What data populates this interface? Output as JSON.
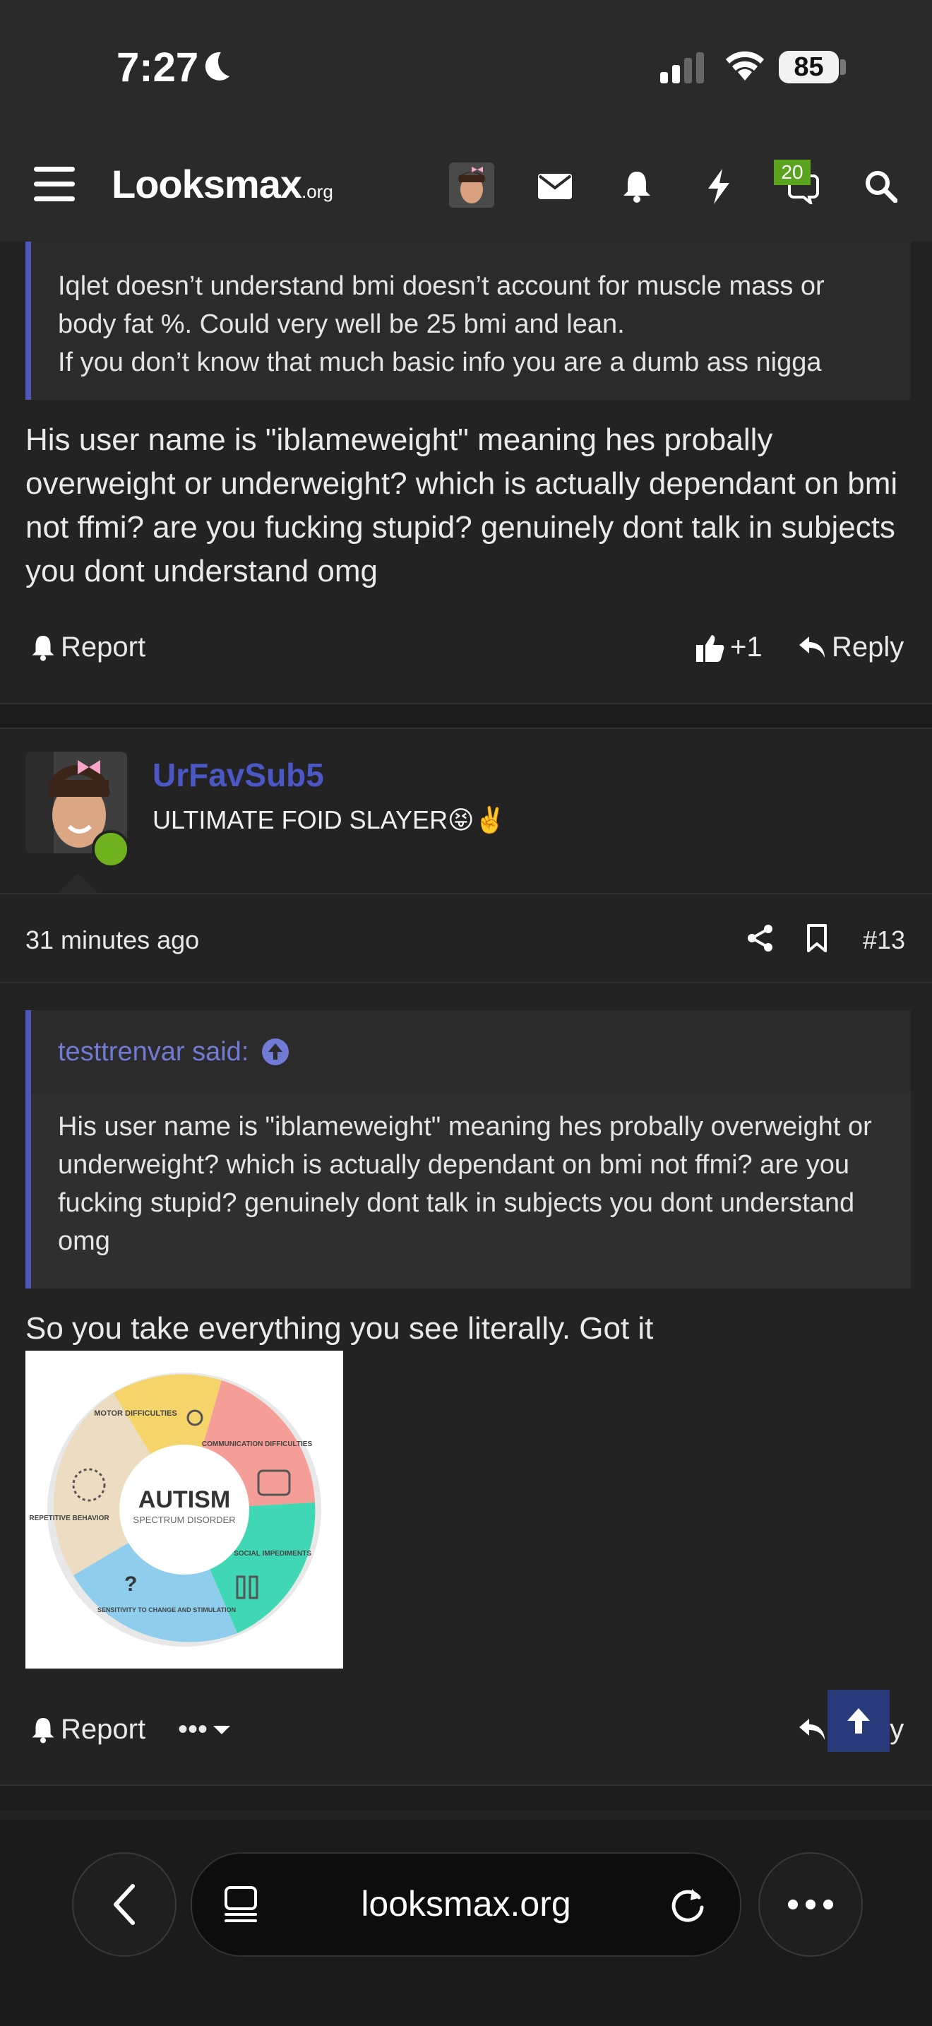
{
  "status": {
    "time": "7:27",
    "battery": "85"
  },
  "nav": {
    "logo": "Looksmax",
    "logo_suffix": ".org",
    "chat_badge": "20"
  },
  "post_prev": {
    "quote_lines": [
      "Iqlet doesn’t understand bmi doesn’t account for muscle mass or",
      "body fat %. Could very well be 25 bmi and lean.",
      "If you don’t know that much basic info you are a dumb ass nigga"
    ],
    "body": "His user name is \"iblameweight\" meaning hes probally overweight or underweight? which is actually dependant on bmi not ffmi? are you fucking stupid? genuinely dont talk in subjects you dont understand omg",
    "report": "Report",
    "likes": "+1",
    "reply": "Reply"
  },
  "post": {
    "username": "UrFavSub5",
    "user_title": "ULTIMATE FOID SLAYER😝✌️",
    "time": "31 minutes ago",
    "number": "#13",
    "quote_author": "testtrenvar said:",
    "quote_text": "His user name is \"iblameweight\" meaning hes probally overweight or underweight? which is actually dependant on bmi not ffmi? are you fucking stupid? genuinely dont talk in subjects you dont understand omg",
    "body": "So you take everything you see literally. Got it",
    "image": {
      "title": "AUTISM",
      "subtitle": "SPECTRUM DISORDER",
      "segments": [
        "MOTOR DIFFICULTIES",
        "COMMUNICATION DIFFICULTIES",
        "SOCIAL IMPEDIMENTS",
        "SENSITIVITY TO CHANGE AND STIMULATION",
        "REPETITIVE BEHAVIOR"
      ]
    },
    "report": "Report",
    "more": "•••",
    "reply": "Reply"
  },
  "browser": {
    "url": "looksmax.org"
  },
  "colors": {
    "accent": "#4d57b8",
    "username": "#4a57c5",
    "online": "#6fb21d",
    "badge": "#5aa31e"
  }
}
